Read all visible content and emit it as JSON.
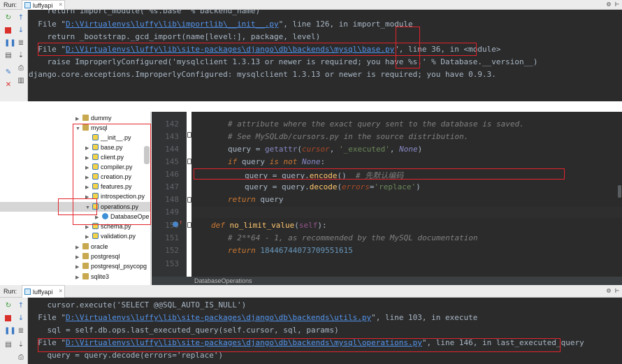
{
  "top_run": {
    "label": "Run:",
    "tab_title": "luffyapi",
    "tab_close": "×",
    "lines": [
      {
        "type": "plain",
        "text": "    return import_module('%s.base' % backend_name)"
      },
      {
        "type": "file",
        "pre": "  File \"",
        "path": "D:\\Virtualenvs\\luffy\\lib\\importlib\\__init__.py",
        "post": "\", line 126, in import_module"
      },
      {
        "type": "plain",
        "text": "    return _bootstrap._gcd_import(name[level:], package, level)"
      },
      {
        "type": "file",
        "pre": "  File \"",
        "path": "D:\\Virtualenvs\\luffy\\lib\\site-packages\\django\\db\\backends\\mysql\\base.py",
        "post": "\", line 36, in <module>"
      },
      {
        "type": "plain",
        "text": "    raise ImproperlyConfigured('mysqlclient 1.3.13 or newer is required; you have %s.' % Database.__version__)"
      },
      {
        "type": "plain",
        "text": "django.core.exceptions.ImproperlyConfigured: mysqlclient 1.3.13 or newer is required; you have 0.9.3."
      }
    ]
  },
  "tree": {
    "items": [
      {
        "label": "dummy",
        "icon": "folder",
        "arrow": "▶"
      },
      {
        "label": "mysql",
        "icon": "folder",
        "arrow": "▼"
      },
      {
        "label": "__init__.py",
        "icon": "py",
        "arrow": ""
      },
      {
        "label": "base.py",
        "icon": "py",
        "arrow": "▶"
      },
      {
        "label": "client.py",
        "icon": "py",
        "arrow": "▶"
      },
      {
        "label": "compiler.py",
        "icon": "py",
        "arrow": "▶"
      },
      {
        "label": "creation.py",
        "icon": "py",
        "arrow": "▶"
      },
      {
        "label": "features.py",
        "icon": "py",
        "arrow": "▶"
      },
      {
        "label": "introspection.py",
        "icon": "py",
        "arrow": "▶"
      },
      {
        "label": "operations.py",
        "icon": "py",
        "arrow": "▼"
      },
      {
        "label": "DatabaseOpe",
        "icon": "cls",
        "arrow": "▶"
      },
      {
        "label": "schema.py",
        "icon": "py",
        "arrow": "▶"
      },
      {
        "label": "validation.py",
        "icon": "py",
        "arrow": "▶"
      },
      {
        "label": "oracle",
        "icon": "folder",
        "arrow": "▶"
      },
      {
        "label": "postgresql",
        "icon": "folder",
        "arrow": "▶"
      },
      {
        "label": "postgresql_psycopg",
        "icon": "folder",
        "arrow": "▶"
      },
      {
        "label": "sqlite3",
        "icon": "folder",
        "arrow": "▶"
      }
    ]
  },
  "editor": {
    "line_numbers": [
      "142",
      "143",
      "144",
      "145",
      "146",
      "147",
      "148",
      "149",
      "150",
      "151",
      "152",
      "153"
    ],
    "code": {
      "l142_comment": "# attribute where the exact query sent to the database is saved.",
      "l143_comment": "# See MySQLdb/cursors.py in the source distribution.",
      "l144_a": "query = ",
      "l144_fn": "getattr",
      "l144_b": "(",
      "l144_param": "cursor",
      "l144_c": ", ",
      "l144_str": "'_executed'",
      "l144_d": ", ",
      "l144_none": "None",
      "l144_e": ")",
      "l145_kw1": "if",
      "l145_a": " query ",
      "l145_kw2": "is not",
      "l145_b": " ",
      "l145_none": "None",
      "l145_c": ":",
      "l146_a": "query = query.",
      "l146_fn": "encode",
      "l146_b": "()  ",
      "l146_comment": "# 先默认编码",
      "l147_a": "query = query.",
      "l147_fn": "decode",
      "l147_b": "(",
      "l147_param": "errors",
      "l147_c": "=",
      "l147_str": "'replace'",
      "l147_d": ")",
      "l148_kw": "return",
      "l148_a": " query",
      "l150_kw": "def",
      "l150_a": " ",
      "l150_fn": "no_limit_value",
      "l150_b": "(",
      "l150_self": "self",
      "l150_c": "):",
      "l151_comment": "# 2**64 - 1, as recommended by the MySQL documentation",
      "l152_kw": "return",
      "l152_a": " ",
      "l152_num": "18446744073709551615"
    },
    "breadcrumb": "DatabaseOperations"
  },
  "bottom_run": {
    "label": "Run:",
    "tab_title": "luffyapi",
    "tab_close": "×",
    "lines": [
      {
        "type": "plain",
        "text": "    cursor.execute('SELECT @@SQL_AUTO_IS_NULL')"
      },
      {
        "type": "file",
        "pre": "  File \"",
        "path": "D:\\Virtualenvs\\luffy\\lib\\site-packages\\django\\db\\backends\\utils.py",
        "post": "\", line 103, in execute"
      },
      {
        "type": "plain",
        "text": "    sql = self.db.ops.last_executed_query(self.cursor, sql, params)"
      },
      {
        "type": "file",
        "pre": "  File \"",
        "path": "D:\\Virtualenvs\\luffy\\lib\\site-packages\\django\\db\\backends\\mysql\\operations.py",
        "post": "\", line 146, in last_executed_query"
      },
      {
        "type": "plain",
        "text": "    query = query.decode(errors='replace')"
      }
    ]
  },
  "colors": {
    "console_bg": "#2b2b2b",
    "highlight_box": "#e2242c",
    "link": "#5394ec"
  }
}
